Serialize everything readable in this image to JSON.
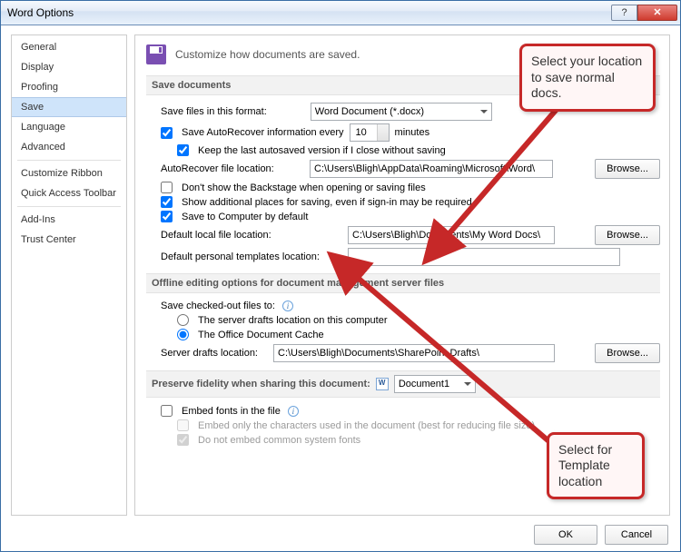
{
  "window": {
    "title": "Word Options"
  },
  "sidebar": {
    "items": [
      {
        "label": "General"
      },
      {
        "label": "Display"
      },
      {
        "label": "Proofing"
      },
      {
        "label": "Save",
        "selected": true
      },
      {
        "label": "Language"
      },
      {
        "label": "Advanced"
      },
      {
        "label": "Customize Ribbon"
      },
      {
        "label": "Quick Access Toolbar"
      },
      {
        "label": "Add-Ins"
      },
      {
        "label": "Trust Center"
      }
    ]
  },
  "intro": "Customize how documents are saved.",
  "sections": {
    "save_docs": {
      "header": "Save documents",
      "format_label": "Save files in this format:",
      "format_value": "Word Document (*.docx)",
      "autorecover_label": "Save AutoRecover information every",
      "autorecover_value": "10",
      "autorecover_unit": "minutes",
      "keep_last_label": "Keep the last autosaved version if I close without saving",
      "autorecover_loc_label": "AutoRecover file location:",
      "autorecover_loc_value": "C:\\Users\\Bligh\\AppData\\Roaming\\Microsoft\\Word\\",
      "browse": "Browse...",
      "no_backstage_label": "Don't show the Backstage when opening or saving files",
      "addl_places_label": "Show additional places for saving, even if sign-in may be required.",
      "save_computer_label": "Save to Computer by default",
      "default_local_label": "Default local file location:",
      "default_local_value": "C:\\Users\\Bligh\\Documents\\My Word Docs\\",
      "templates_label": "Default personal templates location:",
      "templates_value": ""
    },
    "offline": {
      "header": "Offline editing options for document management server files",
      "checked_out_label": "Save checked-out files to:",
      "radio1": "The server drafts location on this computer",
      "radio2": "The Office Document Cache",
      "server_drafts_label": "Server drafts location:",
      "server_drafts_value": "C:\\Users\\Bligh\\Documents\\SharePoint Drafts\\"
    },
    "fidelity": {
      "header": "Preserve fidelity when sharing this document:",
      "doc_name": "Document1",
      "embed_fonts": "Embed fonts in the file",
      "embed_subset": "Embed only the characters used in the document (best for reducing file size)",
      "no_common": "Do not embed common system fonts"
    }
  },
  "footer": {
    "ok": "OK",
    "cancel": "Cancel"
  },
  "callouts": {
    "c1": "Select your location to save normal docs.",
    "c2": "Select for Template location"
  }
}
